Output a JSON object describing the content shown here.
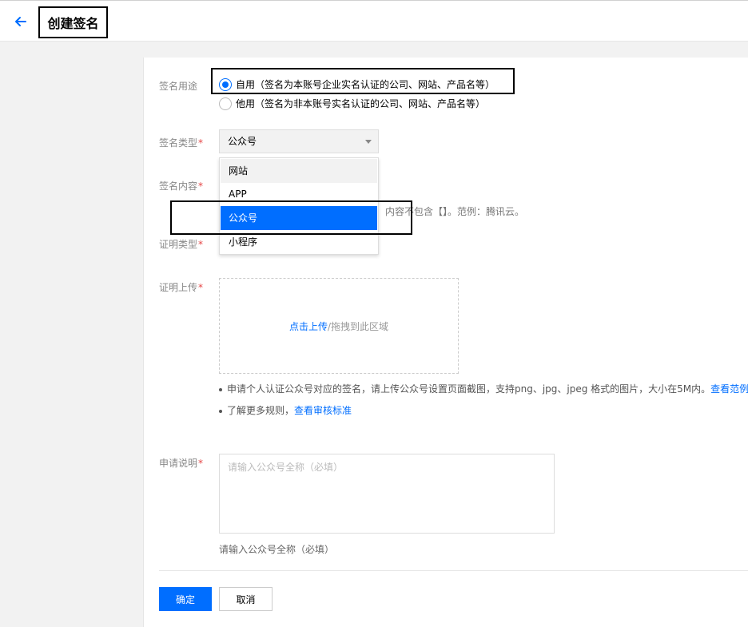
{
  "header": {
    "title": "创建签名",
    "back_icon": "arrow-left-icon"
  },
  "colors": {
    "accent": "#006eff",
    "required": "#e54545"
  },
  "form": {
    "usage": {
      "label": "签名用途",
      "options": [
        {
          "label": "自用（签名为本账号企业实名认证的公司、网站、产品名等）",
          "checked": true
        },
        {
          "label": "他用（签名为非本账号实名认证的公司、网站、产品名等）",
          "checked": false
        }
      ]
    },
    "type": {
      "label": "签名类型",
      "required_mark": "*",
      "selected": "公众号",
      "options": [
        "网站",
        "APP",
        "公众号",
        "小程序"
      ]
    },
    "content": {
      "label": "签名内容",
      "required_mark": "*",
      "hint": "内容不包含【】。范例：腾讯云。"
    },
    "proof_type": {
      "label": "证明类型",
      "required_mark": "*"
    },
    "proof_upload": {
      "label": "证明上传",
      "required_mark": "*",
      "upload_link": "点击上传",
      "upload_text": "/拖拽到此区域",
      "note1_text": "申请个人认证公众号对应的签名，请上传公众号设置页面截图，支持png、jpg、jpeg 格式的图片，大小在5M内。",
      "note1_link": "查看范例",
      "note2_text": "了解更多规则，",
      "note2_link": "查看审核标准"
    },
    "description": {
      "label": "申请说明",
      "required_mark": "*",
      "placeholder": "请输入公众号全称（必填）",
      "hint": "请输入公众号全称（必填）"
    }
  },
  "actions": {
    "confirm_label": "确定",
    "cancel_label": "取消"
  }
}
